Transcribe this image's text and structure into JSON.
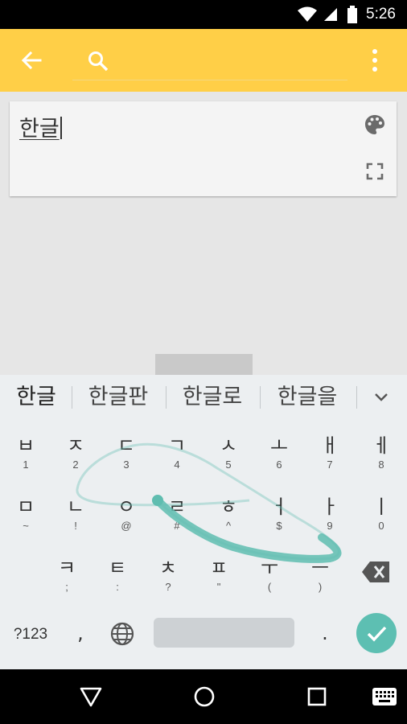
{
  "status_bar": {
    "time": "5:26",
    "icons": [
      "wifi-icon",
      "cell-signal-icon",
      "battery-icon"
    ]
  },
  "app_bar": {
    "back_icon": "arrow-back-icon",
    "search_icon": "search-icon",
    "search_placeholder": "",
    "more_icon": "more-vert-icon"
  },
  "editor": {
    "text": "한글",
    "palette_icon": "palette-icon",
    "fullscreen_icon": "fullscreen-icon"
  },
  "suggestions": [
    "한글",
    "한글판",
    "한글로",
    "한글을"
  ],
  "keyboard": {
    "rows": [
      [
        {
          "main": "ㅂ",
          "hint": "1"
        },
        {
          "main": "ㅈ",
          "hint": "2"
        },
        {
          "main": "ㄷ",
          "hint": "3"
        },
        {
          "main": "ㄱ",
          "hint": "4"
        },
        {
          "main": "ㅅ",
          "hint": "5"
        },
        {
          "main": "ㅗ",
          "hint": "6"
        },
        {
          "main": "ㅐ",
          "hint": "7"
        },
        {
          "main": "ㅔ",
          "hint": "8"
        }
      ],
      [
        {
          "main": "ㅁ",
          "hint": "~"
        },
        {
          "main": "ㄴ",
          "hint": "!"
        },
        {
          "main": "ㅇ",
          "hint": "@"
        },
        {
          "main": "ㄹ",
          "hint": "#"
        },
        {
          "main": "ㅎ",
          "hint": "^"
        },
        {
          "main": "ㅓ",
          "hint": "$"
        },
        {
          "main": "ㅏ",
          "hint": "9"
        },
        {
          "main": "ㅣ",
          "hint": "0"
        }
      ],
      [
        {
          "main": "ㅋ",
          "hint": ";"
        },
        {
          "main": "ㅌ",
          "hint": ":"
        },
        {
          "main": "ㅊ",
          "hint": "?"
        },
        {
          "main": "ㅍ",
          "hint": "\""
        },
        {
          "main": "ㅜ",
          "hint": "("
        },
        {
          "main": "ㅡ",
          "hint": ")"
        }
      ]
    ],
    "symbols_label": "?123",
    "comma_label": ",",
    "period_label": ".",
    "space_label": "",
    "globe_icon": "globe-icon",
    "backspace_icon": "backspace-icon",
    "enter_icon": "check-icon",
    "accent_color": "#5dbfb2",
    "swipe_trail_color": "#5fbdb0"
  },
  "nav_bar": {
    "icons": [
      "nav-back-icon",
      "nav-home-icon",
      "nav-recents-icon",
      "keyboard-switch-icon"
    ]
  },
  "colors": {
    "app_bar": "#ffcf47",
    "keyboard_bg": "#eceff1",
    "status_bar": "#000000"
  }
}
